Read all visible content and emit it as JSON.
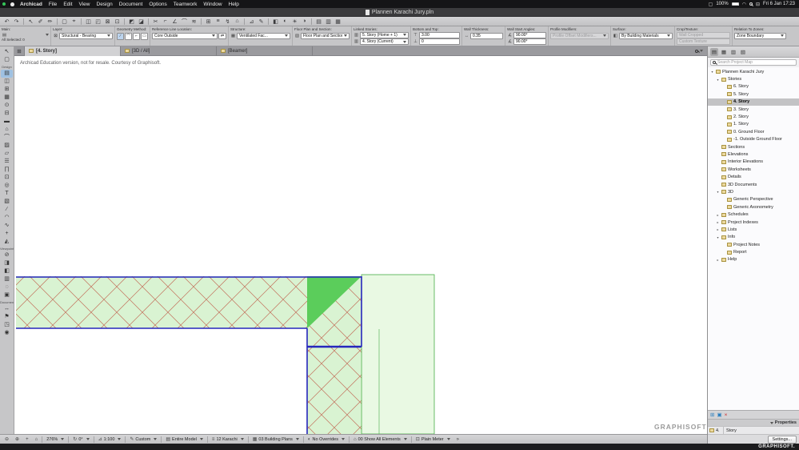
{
  "colors": {
    "wall_outline": "#2626bd",
    "wall_fill": "#d9f3d2",
    "zone_fill": "#e9f9e3",
    "zone_border": "#46ac46",
    "hatch": "#c3705b",
    "triangle_fill": "#5bcd5b",
    "selection": "#c3c3c5",
    "close_red": "#cc2222",
    "tool_blue": "#2a7fbf"
  },
  "glyphs": {
    "wall": "▤",
    "lock": "⊠",
    "swap": "⇄",
    "composite": "▦",
    "fpds": "▧",
    "story": "▥",
    "top": "⊤",
    "bottom": "⊥",
    "thickness": "↔",
    "angle": "∡",
    "surface": "◧",
    "display": "▢",
    "wifi": "◠",
    "cc": "⊟",
    "grid": "⊞",
    "burger": "☰"
  },
  "menubar": {
    "app_name": "Archicad",
    "menus": [
      "File",
      "Edit",
      "View",
      "Design",
      "Document",
      "Options",
      "Teamwork",
      "Window",
      "Help"
    ],
    "battery": "100%",
    "clock": "Fri 6 Jan 17:23"
  },
  "titlebar": {
    "title": "Plannen Karachi Jury.pln"
  },
  "toolbar": {
    "icons": [
      {
        "name": "undo-icon",
        "glyph": "↶"
      },
      {
        "name": "redo-icon",
        "glyph": "↷"
      },
      {
        "sep": true
      },
      {
        "name": "arrow-tool-icon",
        "glyph": "↖"
      },
      {
        "name": "pick-up-parameters-icon",
        "glyph": "✐"
      },
      {
        "name": "inject-parameters-icon",
        "glyph": "✏"
      },
      {
        "sep": true
      },
      {
        "name": "marquee-icon",
        "glyph": "▢"
      },
      {
        "name": "snap-point-icon",
        "glyph": "⌖"
      },
      {
        "sep": true
      },
      {
        "name": "group-icon",
        "glyph": "◫"
      },
      {
        "name": "ungroup-icon",
        "glyph": "◰"
      },
      {
        "name": "lock-icon",
        "glyph": "⊠"
      },
      {
        "name": "unlock-icon",
        "glyph": "⊡"
      },
      {
        "sep": true
      },
      {
        "name": "bring-forward-icon",
        "glyph": "◩"
      },
      {
        "name": "send-backward-icon",
        "glyph": "◪"
      },
      {
        "sep": true
      },
      {
        "name": "split-icon",
        "glyph": "✂"
      },
      {
        "name": "adjust-icon",
        "glyph": "⌐"
      },
      {
        "name": "intersect-icon",
        "glyph": "∠"
      },
      {
        "name": "fillet-icon",
        "glyph": "⌒"
      },
      {
        "name": "offset-icon",
        "glyph": "≋"
      },
      {
        "sep": true
      },
      {
        "name": "grid-snap-icon",
        "glyph": "⊞"
      },
      {
        "name": "guide-lines-icon",
        "glyph": "≡"
      },
      {
        "name": "gravity-icon",
        "glyph": "↯"
      },
      {
        "name": "home-story-icon",
        "glyph": "⌂"
      },
      {
        "sep": true
      },
      {
        "name": "measure-icon",
        "glyph": "⊿"
      },
      {
        "name": "dimension-icon",
        "glyph": "✎"
      },
      {
        "sep": true
      },
      {
        "name": "3d-cutaway-icon",
        "glyph": "◧"
      },
      {
        "name": "shading-icon",
        "glyph": "◐"
      },
      {
        "name": "sun-study-icon",
        "glyph": "☀"
      },
      {
        "name": "shadow-icon",
        "glyph": "◑"
      },
      {
        "sep": true
      },
      {
        "name": "layers-icon",
        "glyph": "▤"
      },
      {
        "name": "story-settings-icon",
        "glyph": "▥"
      },
      {
        "name": "views-icon",
        "glyph": "▦"
      }
    ]
  },
  "infobar": {
    "main_label": "Main:",
    "selection_text": "All Selected: 0",
    "layer_label": "Layer:",
    "layer_value": "Structural - Bearing",
    "geometry_label": "Geometry Method:",
    "geometry_methods": [
      {
        "name": "straight-wall-method",
        "glyph": "∕",
        "active": true
      },
      {
        "name": "curved-wall-method",
        "glyph": "⌒"
      },
      {
        "name": "chained-wall-method",
        "glyph": "⌐"
      },
      {
        "name": "rectangle-wall-method",
        "glyph": "▭"
      }
    ],
    "refline_label": "Reference Line Location:",
    "refline_value": "Core Outside",
    "structure_label": "Structure:",
    "structure_value": "Ventilated Fac...",
    "fps_label": "Floor Plan and Section:",
    "fps_value": "Floor Plan and Section...",
    "linked_label": "Linked Stories:",
    "linked_top": "5. Story (Home + 1)",
    "linked_bottom": "4. Story (Current)",
    "bt_label": "Bottom and Top:",
    "bt_top_value": "3.00",
    "bt_bottom_value": "0",
    "thickness_label": "Wall Thickness:",
    "thickness_value": "0.35",
    "angles_label": "Wall Start Angles:",
    "angle_top": "90.00°",
    "angle_bottom": "90.00°",
    "profile_label": "Profile Modifiers:",
    "profile_value": "Profile Offset Modifiers...",
    "surface_label": "Surface:",
    "surface_value": "By Building Materials",
    "crop_label": "Crop/Texture:",
    "crop_top": "Wall Cropped",
    "crop_bottom": "Custom Texture",
    "zones_label": "Relation To Zones:",
    "zones_value": "Zone Boundary"
  },
  "tabbar": {
    "tabs": [
      {
        "label": "[4. Story]"
      },
      {
        "label": "[3D / All]"
      },
      {
        "label": "[Beamer]"
      }
    ]
  },
  "toolbox": {
    "items": [
      {
        "name": "arrow-tool-icon",
        "glyph": "↖"
      },
      {
        "name": "marquee-tool-icon",
        "glyph": "▢"
      },
      {
        "label": "Design"
      },
      {
        "name": "wall-tool-icon",
        "glyph": "▤",
        "active": true
      },
      {
        "name": "door-tool-icon",
        "glyph": "◫"
      },
      {
        "name": "window-tool-icon",
        "glyph": "⊞"
      },
      {
        "name": "curtain-wall-tool-icon",
        "glyph": "▦"
      },
      {
        "name": "column-tool-icon",
        "glyph": "⊙"
      },
      {
        "name": "beam-tool-icon",
        "glyph": "⊟"
      },
      {
        "name": "slab-tool-icon",
        "glyph": "▬"
      },
      {
        "name": "roof-tool-icon",
        "glyph": "⌂"
      },
      {
        "name": "shell-tool-icon",
        "glyph": "⌒"
      },
      {
        "name": "mesh-tool-icon",
        "glyph": "▨"
      },
      {
        "name": "zone-tool-icon",
        "glyph": "▱"
      },
      {
        "name": "stair-tool-icon",
        "glyph": "☰"
      },
      {
        "name": "railing-tool-icon",
        "glyph": "∏"
      },
      {
        "name": "object-tool-icon",
        "glyph": "⊡"
      },
      {
        "name": "lamp-tool-icon",
        "glyph": "◎"
      },
      {
        "name": "text-tool-icon",
        "glyph": "T"
      },
      {
        "name": "fill-tool-icon",
        "glyph": "▧"
      },
      {
        "name": "line-tool-icon",
        "glyph": "∕"
      },
      {
        "name": "arc-tool-icon",
        "glyph": "◠"
      },
      {
        "name": "spline-tool-icon",
        "glyph": "∿"
      },
      {
        "name": "hotspot-tool-icon",
        "glyph": "+"
      },
      {
        "name": "figure-tool-icon",
        "glyph": "◭"
      },
      {
        "label": "Viewpoints"
      },
      {
        "name": "section-tool-icon",
        "glyph": "⊘"
      },
      {
        "name": "elevation-tool-icon",
        "glyph": "◨"
      },
      {
        "name": "interior-elevation-tool-icon",
        "glyph": "◧"
      },
      {
        "name": "worksheet-tool-icon",
        "glyph": "▥"
      },
      {
        "name": "detail-tool-icon",
        "glyph": "◌"
      },
      {
        "name": "3d-document-tool-icon",
        "glyph": "▣"
      },
      {
        "label": "Document"
      },
      {
        "name": "dimension-tool-icon",
        "glyph": "↔"
      },
      {
        "name": "label-tool-icon",
        "glyph": "⚑"
      },
      {
        "name": "drawing-tool-icon",
        "glyph": "◳"
      },
      {
        "name": "camera-tool-icon",
        "glyph": "◉"
      }
    ]
  },
  "canvas": {
    "education_note": "Archicad Education version, not for resale. Courtesy of Graphisoft.",
    "watermark": "GRAPHISOFT"
  },
  "navigator": {
    "header_icons": [
      {
        "name": "project-map-icon",
        "glyph": "▤",
        "active": true
      },
      {
        "name": "view-map-icon",
        "glyph": "▦"
      },
      {
        "name": "layout-book-icon",
        "glyph": "▥"
      },
      {
        "name": "publisher-icon",
        "glyph": "▧"
      }
    ],
    "search_placeholder": "Search Project Map",
    "tree": [
      {
        "label": "Plannen Karachi Jury",
        "depth": 0,
        "twisty": "▾"
      },
      {
        "label": "Stories",
        "depth": 1,
        "twisty": "▾"
      },
      {
        "label": "6. Story",
        "depth": 2
      },
      {
        "label": "5. Story",
        "depth": 2
      },
      {
        "label": "4. Story",
        "depth": 2,
        "selected": true,
        "bold": true
      },
      {
        "label": "3. Story",
        "depth": 2
      },
      {
        "label": "2. Story",
        "depth": 2
      },
      {
        "label": "1. Story",
        "depth": 2
      },
      {
        "label": "0. Ground Floor",
        "depth": 2
      },
      {
        "label": "-1. Outside Ground Floor",
        "depth": 2
      },
      {
        "label": "Sections",
        "depth": 1
      },
      {
        "label": "Elevations",
        "depth": 1
      },
      {
        "label": "Interior Elevations",
        "depth": 1
      },
      {
        "label": "Worksheets",
        "depth": 1
      },
      {
        "label": "Details",
        "depth": 1
      },
      {
        "label": "3D Documents",
        "depth": 1
      },
      {
        "label": "3D",
        "depth": 1,
        "twisty": "▾"
      },
      {
        "label": "Generic Perspective",
        "depth": 2
      },
      {
        "label": "Generic Axonometry",
        "depth": 2
      },
      {
        "label": "Schedules",
        "depth": 1,
        "twisty": "▸"
      },
      {
        "label": "Project Indexes",
        "depth": 1,
        "twisty": "▸"
      },
      {
        "label": "Lists",
        "depth": 1,
        "twisty": "▸"
      },
      {
        "label": "Info",
        "depth": 1,
        "twisty": "▾"
      },
      {
        "label": "Project Notes",
        "depth": 2
      },
      {
        "label": "Report",
        "depth": 2
      },
      {
        "label": "Help",
        "depth": 1,
        "twisty": "▸"
      }
    ],
    "bottom_icons": [
      {
        "name": "new-item-icon",
        "glyph": "⊞",
        "color": "#2a7fbf"
      },
      {
        "name": "clone-folder-icon",
        "glyph": "▣",
        "color": "#2a7fbf"
      },
      {
        "name": "close-panel-icon",
        "glyph": "×",
        "color": "#cc2222"
      }
    ],
    "properties": {
      "header": "Properties",
      "item_number": "4.",
      "item_name": "Story",
      "settings_label": "Settings..."
    }
  },
  "statusbar": {
    "items": [
      {
        "name": "zoom-out-button",
        "glyph": "⊖"
      },
      {
        "name": "zoom-in-button",
        "glyph": "⊕"
      },
      {
        "name": "pan-button",
        "glyph": "+"
      },
      {
        "name": "fit-in-window-button",
        "glyph": "⌂"
      },
      {
        "sep": true
      },
      {
        "name": "zoom-level-control",
        "label": "276%",
        "dd": true
      },
      {
        "sep": true
      },
      {
        "name": "orientation-control",
        "glyph": "↻",
        "label": "0°",
        "dd": true
      },
      {
        "sep": true
      },
      {
        "name": "scale-control",
        "glyph": "⊿",
        "label": "1:100",
        "dd": true
      },
      {
        "sep": true
      },
      {
        "name": "pen-set-control",
        "glyph": "✎",
        "label": "Custom",
        "dd": true
      },
      {
        "sep": true
      },
      {
        "name": "structure-display-control",
        "glyph": "▤",
        "label": "Entire Model",
        "dd": true
      },
      {
        "sep": true
      },
      {
        "name": "layer-combination-control",
        "glyph": "≡",
        "label": "12 Karachi",
        "dd": true
      },
      {
        "sep": true
      },
      {
        "name": "model-view-options-control",
        "glyph": "▦",
        "label": "03 Building Plans",
        "dd": true
      },
      {
        "sep": true
      },
      {
        "name": "graphic-override-control",
        "glyph": "◐",
        "label": "No Overrides",
        "dd": true
      },
      {
        "sep": true
      },
      {
        "name": "renovation-filter-control",
        "glyph": "⌂",
        "label": "00 Show All Elements",
        "dd": true
      },
      {
        "sep": true
      },
      {
        "name": "measurement-unit-control",
        "glyph": "⊡",
        "label": "Plain Meter",
        "dd": true
      },
      {
        "name": "more-options-chevron",
        "glyph": "»"
      }
    ]
  },
  "footer": {
    "brand": "GRAPHISOFT."
  }
}
